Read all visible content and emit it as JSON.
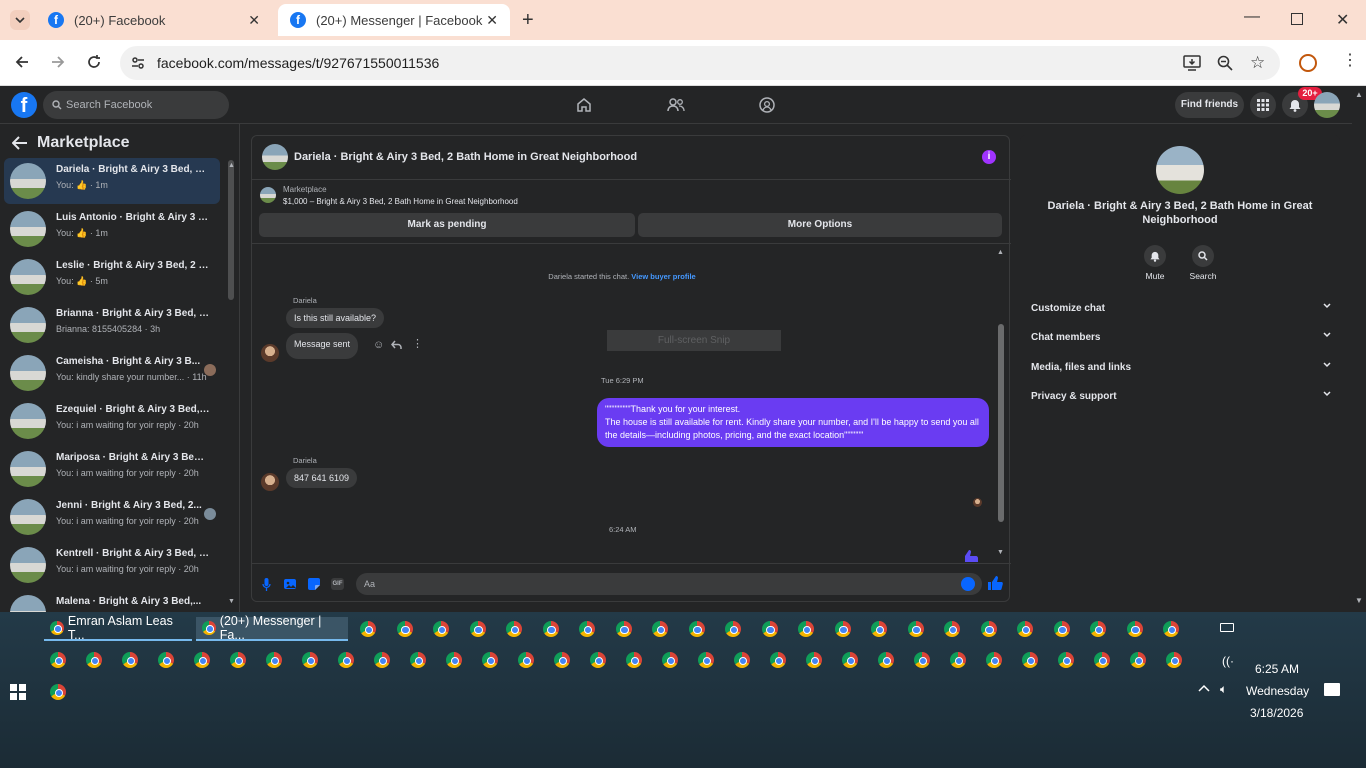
{
  "browser": {
    "tabs": [
      {
        "title": "(20+) Facebook",
        "active": false
      },
      {
        "title": "(20+) Messenger | Facebook",
        "active": true
      }
    ],
    "url": "facebook.com/messages/t/927671550011536"
  },
  "fb_header": {
    "logo": "f",
    "search_placeholder": "Search Facebook",
    "find_friends": "Find friends",
    "notifications_badge": "20+"
  },
  "left": {
    "title": "Marketplace",
    "conversations": [
      {
        "name": "Dariela · Bright & Airy 3 Bed, 2 ...",
        "preview": "You: 👍 · 1m",
        "active": true
      },
      {
        "name": "Luis Antonio · Bright & Airy 3 B...",
        "preview": "You: 👍 · 1m",
        "active": false
      },
      {
        "name": "Leslie · Bright & Airy 3 Bed, 2 B...",
        "preview": "You: 👍 · 5m",
        "active": false
      },
      {
        "name": "Brianna · Bright & Airy 3 Bed, 2...",
        "preview": "Brianna: 8155405284 · 3h",
        "active": false
      },
      {
        "name": "Cameisha · Bright & Airy 3 B...",
        "preview": "You: kindly share your number... · 11h",
        "active": false
      },
      {
        "name": "Ezequiel · Bright & Airy 3 Bed, ...",
        "preview": "You: i am waiting for yoir reply · 20h",
        "active": false
      },
      {
        "name": "Mariposa · Bright & Airy 3 Bed,...",
        "preview": "You: i am waiting for yoir reply · 20h",
        "active": false
      },
      {
        "name": "Jenni · Bright & Airy 3 Bed, 2...",
        "preview": "You: i am waiting for yoir reply · 20h",
        "active": false
      },
      {
        "name": "Kentrell · Bright & Airy 3 Bed, 2...",
        "preview": "You: i am waiting for yoir reply · 20h",
        "active": false
      },
      {
        "name": "Malena · Bright & Airy 3 Bed,...",
        "preview": "",
        "active": false
      }
    ]
  },
  "chat": {
    "title": "Dariela · Bright & Airy 3 Bed, 2 Bath Home in Great Neighborhood",
    "listing_label": "Marketplace",
    "listing_price": "$1,000 – Bright & Airy 3 Bed, 2 Bath Home in Great Neighborhood",
    "mark_pending": "Mark as pending",
    "more_options": "More Options",
    "started_text": "Dariela started this chat.",
    "view_buyer": "View buyer profile",
    "sender1": "Dariela",
    "msg1": "Is this still available?",
    "msg2": "Message sent",
    "snip_overlay": "Full-screen Snip",
    "time1": "Tue 6:29 PM",
    "out_msg": "\"\"\"\"\"\"\"\"Thank you for your interest.\nThe house is still available for rent. Kindly share your number, and I'll be happy to send you all the details—including photos, pricing, and the exact location\"\"\"\"\"\"",
    "sender2": "Dariela",
    "msg3": "847 641 6109",
    "time2": "6:24 AM",
    "composer_placeholder": "Aa"
  },
  "info_panel": {
    "title": "Dariela · Bright & Airy 3 Bed, 2 Bath Home in Great Neighborhood",
    "mute": "Mute",
    "search": "Search",
    "sections": [
      "Customize chat",
      "Chat members",
      "Media, files and links",
      "Privacy & support"
    ]
  },
  "taskbar": {
    "windows": [
      "Emran Aslam Leas T...",
      "(20+) Messenger | Fa..."
    ],
    "time": "6:25 AM",
    "day": "Wednesday",
    "date": "3/18/2026"
  },
  "colors": {
    "accent": "#0866ff",
    "outgoing_bubble": "#6a3cf2",
    "tabstrip": "#fadfd2"
  }
}
